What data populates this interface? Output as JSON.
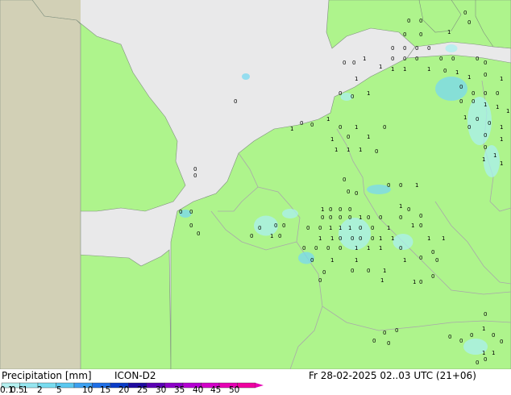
{
  "map": {
    "colors": {
      "sea": "#e9e9ea",
      "land_model": "#aef48c",
      "land_outside": "#d2d0b6",
      "border": "#a9a9a9",
      "coast": "#7f8f7f",
      "rain_light": "#aaf0f0",
      "rain_mid": "#78d8f0"
    },
    "labels": {
      "field": "Precipitation [mm]",
      "model": "ICON-D2",
      "valid_time": "Fr 28-02-2025 02..03 UTC (21+06)"
    }
  },
  "legend": {
    "ticks": [
      "0.1",
      "0.5",
      "1",
      "2",
      "5",
      "10",
      "15",
      "20",
      "25",
      "30",
      "35",
      "40",
      "45",
      "50"
    ],
    "colors": [
      "#b4f0f0",
      "#96e6f0",
      "#78dcf0",
      "#5ac8f0",
      "#3ca0f0",
      "#1e6ee6",
      "#0a3cc8",
      "#1e0aa0",
      "#5a00b4",
      "#8c00c8",
      "#b400d2",
      "#d200c8",
      "#e600b4",
      "#f000a0"
    ]
  }
}
